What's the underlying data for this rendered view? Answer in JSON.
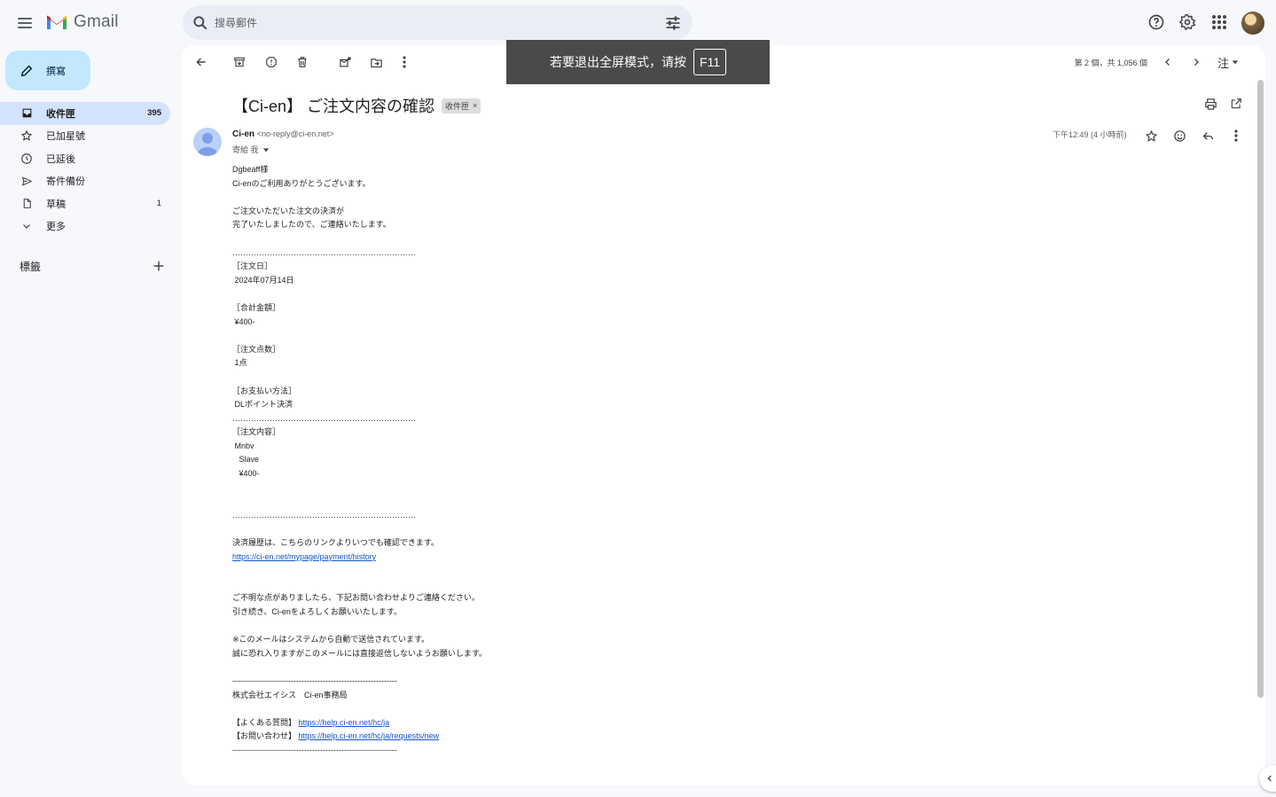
{
  "app": {
    "name": "Gmail"
  },
  "search": {
    "placeholder": "搜尋郵件"
  },
  "sidebar": {
    "compose_label": "撰寫",
    "items": [
      {
        "label": "收件匣",
        "count": "395",
        "icon": "inbox-icon"
      },
      {
        "label": "已加星號",
        "count": "",
        "icon": "star-icon"
      },
      {
        "label": "已延後",
        "count": "",
        "icon": "clock-icon"
      },
      {
        "label": "寄件備份",
        "count": "",
        "icon": "send-icon"
      },
      {
        "label": "草稿",
        "count": "1",
        "icon": "draft-icon"
      },
      {
        "label": "更多",
        "count": "",
        "icon": "chevron-down-icon"
      }
    ],
    "labels_title": "標籤"
  },
  "toolbar": {
    "pager": "第 2 個，共 1,056 個",
    "lang": "注"
  },
  "fullscreen": {
    "text": "若要退出全屏模式，请按",
    "key": "F11"
  },
  "message": {
    "subject": "【Ci-en】 ご注文内容の確認",
    "label_chip": "收件匣",
    "chip_close": "×",
    "sender_name": "Ci-en",
    "sender_email": "<no-reply@ci-en.net>",
    "to": "寄給 我",
    "time": "下午12:49 (4 小時前)",
    "body": [
      {
        "text": "Dgbeaff様"
      },
      {
        "text": "Ci-enのご利用ありがとうございます。"
      },
      {
        "text": ""
      },
      {
        "text": "ご注文いただいた注文の決済が"
      },
      {
        "text": "完了いたしましたので、ご連絡いたします。"
      },
      {
        "text": ""
      },
      {
        "text": "……………………………………………………………"
      },
      {
        "text": "［注文日］"
      },
      {
        "text": " 2024年07月14日"
      },
      {
        "text": ""
      },
      {
        "text": "［合計金額］"
      },
      {
        "text": " ¥400-"
      },
      {
        "text": ""
      },
      {
        "text": "［注文点数］"
      },
      {
        "text": " 1点"
      },
      {
        "text": ""
      },
      {
        "text": "［お支払い方法］"
      },
      {
        "text": " DLポイント決済"
      },
      {
        "text": "……………………………………………………………"
      },
      {
        "text": "［注文内容］"
      },
      {
        "text": " Mnbv"
      },
      {
        "text": "   Slave"
      },
      {
        "text": "   ¥400-"
      },
      {
        "text": ""
      },
      {
        "text": ""
      },
      {
        "text": "……………………………………………………………"
      },
      {
        "text": ""
      },
      {
        "text": "決済履歴は、こちらのリンクよりいつでも確認できます。"
      },
      {
        "link": "https://ci-en.net/mypage/payment/history"
      },
      {
        "text": ""
      },
      {
        "text": ""
      },
      {
        "text": "ご不明な点がありましたら、下記お問い合わせよりご連絡ください。"
      },
      {
        "text": "引き続き、Ci-enをよろしくお願いいたします。"
      },
      {
        "text": ""
      },
      {
        "text": "※このメールはシステムから自動で送信されています。"
      },
      {
        "text": "誠に恐れ入りますがこのメールには直接返信しないようお願いします。"
      },
      {
        "text": ""
      },
      {
        "text": "--------------------------------------------------------------"
      },
      {
        "text": "株式会社エイシス　Ci-en事務局"
      },
      {
        "text": ""
      },
      {
        "text": "【よくある質問】 ",
        "link": "https://help.ci-en.net/hc/ja"
      },
      {
        "text": "【お問い合わせ】 ",
        "link": "https://help.ci-en.net/hc/ja/requests/new"
      },
      {
        "text": "--------------------------------------------------------------"
      }
    ]
  },
  "colors": {
    "accent": "#c2e7ff",
    "active_nav": "#d3e3fd",
    "link": "#1155cc"
  }
}
